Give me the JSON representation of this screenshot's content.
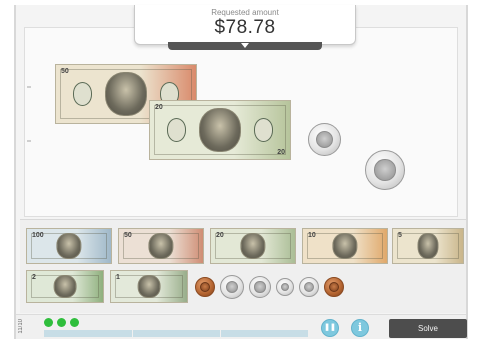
{
  "requested": {
    "label": "Requested amount",
    "amount": "$78.78"
  },
  "workspace": {
    "bills": [
      {
        "name": "fifty-dollar-bill",
        "denomination": "50",
        "color": "#ece4cf",
        "accent": "#d98a6b"
      },
      {
        "name": "twenty-dollar-bill",
        "denomination": "20",
        "color": "#e6ead7",
        "accent": "#b6c49b"
      }
    ],
    "coins": [
      {
        "name": "quarter-coin"
      },
      {
        "name": "half-dollar-coin"
      }
    ]
  },
  "tray": {
    "bills": [
      {
        "name": "tray-hundred-dollar-bill",
        "denomination": "100",
        "color": "#dce6ea",
        "accent": "#9fb8c9"
      },
      {
        "name": "tray-fifty-dollar-bill",
        "denomination": "50",
        "color": "#ece0d5",
        "accent": "#cf8d74"
      },
      {
        "name": "tray-twenty-dollar-bill",
        "denomination": "20",
        "color": "#e3e8d6",
        "accent": "#aabd95"
      },
      {
        "name": "tray-ten-dollar-bill",
        "denomination": "10",
        "color": "#efe1c8",
        "accent": "#e0a86a"
      },
      {
        "name": "tray-five-dollar-bill",
        "denomination": "5",
        "color": "#ece4cd",
        "accent": "#c9b58a"
      },
      {
        "name": "tray-two-dollar-bill",
        "denomination": "2",
        "color": "#dfe8d7",
        "accent": "#8fb07e"
      },
      {
        "name": "tray-one-dollar-bill",
        "denomination": "1",
        "color": "#e3e9da",
        "accent": "#98ad8a"
      }
    ],
    "coins": [
      {
        "name": "tray-penny-coin",
        "kind": "copper"
      },
      {
        "name": "tray-half-dollar-coin",
        "kind": "silver"
      },
      {
        "name": "tray-quarter-coin",
        "kind": "silver"
      },
      {
        "name": "tray-dime-coin",
        "kind": "silver"
      },
      {
        "name": "tray-nickel-coin",
        "kind": "silver"
      },
      {
        "name": "tray-copper-coin",
        "kind": "copper"
      }
    ]
  },
  "footer": {
    "side_label": "11/10",
    "progress_dots": 3,
    "progress_segments": 3,
    "pause_glyph": "❚❚",
    "info_glyph": "i",
    "solve_label": "Solve"
  },
  "colors": {
    "accent_green": "#2fbe3c",
    "accent_blue": "#7ec8de",
    "solve_bg": "#4d4d4d"
  }
}
